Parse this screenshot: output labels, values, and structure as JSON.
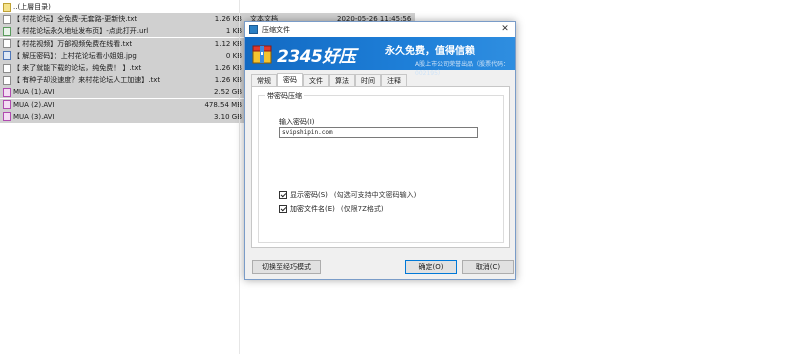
{
  "files": [
    {
      "name": "..(上層目录)",
      "size": "",
      "type": "",
      "date": "",
      "icon": "up-icon",
      "selected": false
    },
    {
      "name": "【 村花论坛】全免费-无套路-更新快.txt",
      "size": "1.26 KB",
      "type": "文本文档",
      "date": "2020-05-26 11:45:56",
      "icon": "text-file-icon",
      "selected": true
    },
    {
      "name": "【 村花论坛永久地址发布页】-点此打开.url",
      "size": "1 KB",
      "type": "In",
      "date": "",
      "icon": "url-file-icon",
      "selected": true
    },
    {
      "name": "【 村花视频】万部视频免费在线看.txt",
      "size": "1.12 KB",
      "type": "文",
      "date": "",
      "icon": "text-file-icon",
      "selected": true
    },
    {
      "name": "【 解压密码】：上村花论坛看小姐姐.jpg",
      "size": "0 KB",
      "type": "JF",
      "date": "",
      "icon": "image-file-icon",
      "selected": true
    },
    {
      "name": "【 来了就能下载的论坛，纯免费！ 】.txt",
      "size": "1.26 KB",
      "type": "文",
      "date": "",
      "icon": "text-file-icon",
      "selected": true
    },
    {
      "name": "【 有种子却没速度？来村花论坛人工加速】.txt",
      "size": "1.26 KB",
      "type": "文",
      "date": "",
      "icon": "text-file-icon",
      "selected": true
    },
    {
      "name": "MUA (1).AVI",
      "size": "2.52 GB",
      "type": "A",
      "date": "",
      "icon": "video-file-icon",
      "selected": true
    },
    {
      "name": "MUA (2).AVI",
      "size": "478.54 MB",
      "type": "A",
      "date": "",
      "icon": "video-file-icon",
      "selected": true
    },
    {
      "name": "MUA (3).AVI",
      "size": "3.10 GB",
      "type": "A",
      "date": "",
      "icon": "video-file-icon",
      "selected": true
    }
  ],
  "dialog": {
    "title": "压缩文件",
    "close": "✕",
    "banner": {
      "brand": "2345好压",
      "slogan": "永久免费，值得信赖",
      "sub": "A股上市公司荣誉出品（股票代码：002195）"
    },
    "tabs": [
      "常规",
      "密码",
      "文件",
      "算法",
      "时间",
      "注释"
    ],
    "active_tab": "密码",
    "group_label": "带密码压缩",
    "password_label": "输入密码(I)",
    "password_value": "svipshipin.com",
    "show_password_label": "显示密码(S)",
    "show_password_hint": "(勾选可支持中文密码输入)",
    "show_password_checked": true,
    "encrypt_names_label": "加密文件名(E)",
    "encrypt_names_hint": "(仅限7Z格式)",
    "encrypt_names_checked": true,
    "switch_mode_button": "切换至经巧模式",
    "ok_button": "确定(O)",
    "cancel_button": "取消(C)"
  }
}
